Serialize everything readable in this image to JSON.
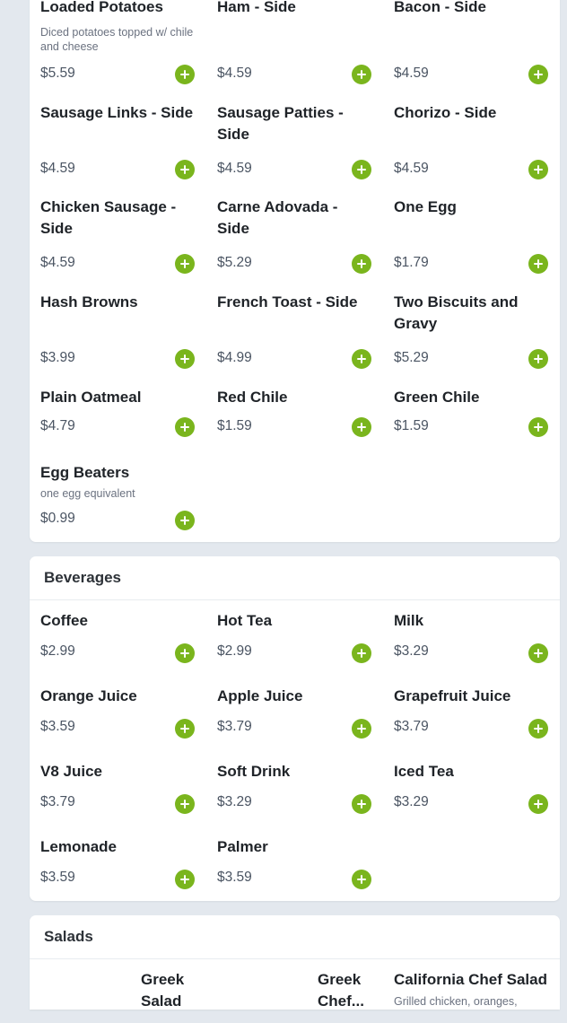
{
  "sides": {
    "rows": [
      [
        {
          "name": "Loaded Potatoes",
          "desc": "Diced potatoes topped w/ chile and cheese",
          "price": "$5.59"
        },
        {
          "name": "Ham - Side",
          "price": "$4.59"
        },
        {
          "name": "Bacon - Side",
          "price": "$4.59"
        }
      ],
      [
        {
          "name": "Sausage Links - Side",
          "price": "$4.59"
        },
        {
          "name": "Sausage Patties - Side",
          "price": "$4.59"
        },
        {
          "name": "Chorizo - Side",
          "price": "$4.59"
        }
      ],
      [
        {
          "name": "Chicken Sausage - Side",
          "price": "$4.59"
        },
        {
          "name": "Carne Adovada - Side",
          "price": "$5.29"
        },
        {
          "name": "One Egg",
          "price": "$1.79"
        }
      ],
      [
        {
          "name": "Hash Browns",
          "price": "$3.99"
        },
        {
          "name": "French Toast - Side",
          "price": "$4.99"
        },
        {
          "name": "Two Biscuits and Gravy",
          "price": "$5.29"
        }
      ],
      [
        {
          "name": "Plain Oatmeal",
          "price": "$4.79"
        },
        {
          "name": "Red Chile",
          "price": "$1.59"
        },
        {
          "name": "Green Chile",
          "price": "$1.59"
        }
      ],
      [
        {
          "name": "Egg Beaters",
          "desc": "one egg equivalent",
          "price": "$0.99"
        }
      ]
    ]
  },
  "beverages": {
    "title": "Beverages",
    "rows": [
      [
        {
          "name": "Coffee",
          "price": "$2.99"
        },
        {
          "name": "Hot Tea",
          "price": "$2.99"
        },
        {
          "name": "Milk",
          "price": "$3.29"
        }
      ],
      [
        {
          "name": "Orange Juice",
          "price": "$3.59"
        },
        {
          "name": "Apple Juice",
          "price": "$3.79"
        },
        {
          "name": "Grapefruit Juice",
          "price": "$3.79"
        }
      ],
      [
        {
          "name": "V8 Juice",
          "price": "$3.79"
        },
        {
          "name": "Soft Drink",
          "price": "$3.29"
        },
        {
          "name": "Iced Tea",
          "price": "$3.29"
        }
      ],
      [
        {
          "name": "Lemonade",
          "price": "$3.59"
        },
        {
          "name": "Palmer",
          "price": "$3.59"
        }
      ]
    ]
  },
  "salads": {
    "title": "Salads",
    "items": [
      {
        "name": "Greek Salad"
      },
      {
        "name": "Greek Chef..."
      },
      {
        "name": "California Chef Salad",
        "desc": "Grilled chicken, oranges,"
      }
    ]
  },
  "colors": {
    "add_button": "#7ab51d",
    "page_bg": "#e3e8ee",
    "card_bg": "#ffffff"
  },
  "icons": {
    "add": "plus-icon"
  }
}
